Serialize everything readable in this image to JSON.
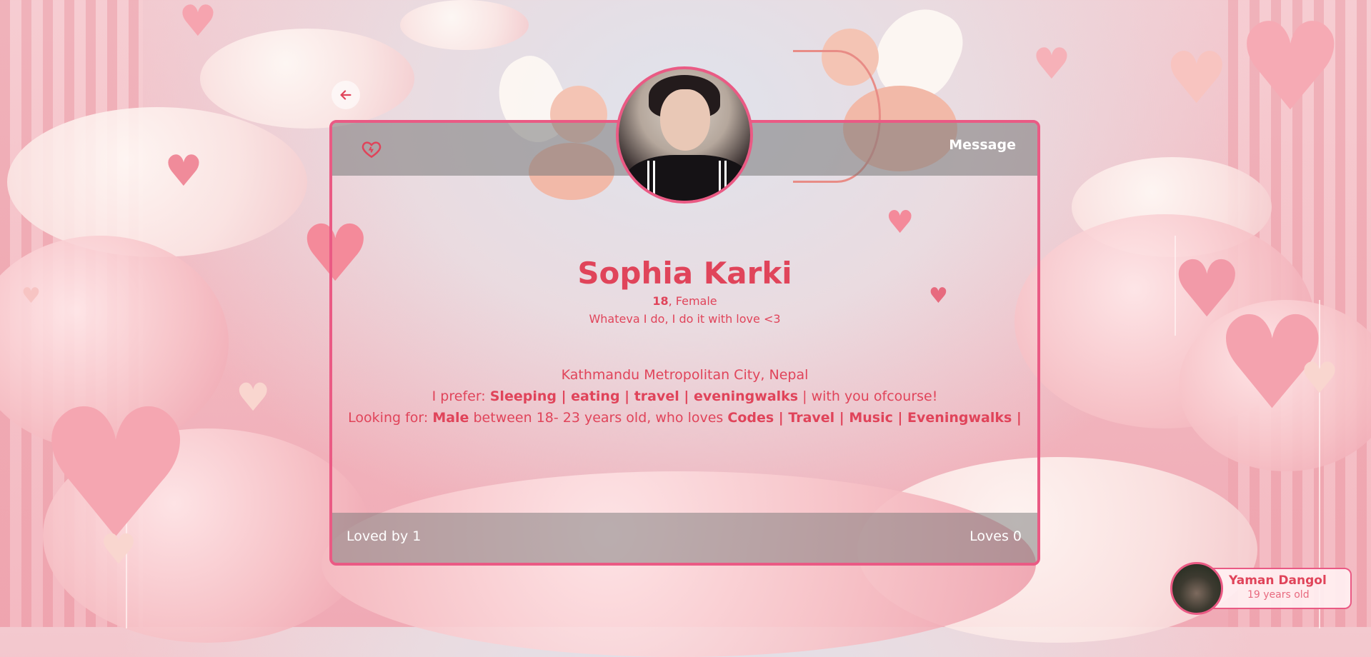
{
  "profile": {
    "name": "Sophia Karki",
    "age": "18",
    "gender_suffix": ", Female",
    "bio": "Whateva I do, I do it with love <3",
    "location": "Kathmandu Metropolitan City, Nepal",
    "prefer_label": "I prefer: ",
    "prefer_items": "Sleeping | eating | travel | eveningwalks",
    "prefer_suffix": " | with you ofcourse!",
    "looking_label": "Looking for: ",
    "looking_gender": "Male",
    "looking_middle": " between 18- 23 years old, who loves ",
    "looking_items": "Codes | Travel | Music | Eveningwalks |"
  },
  "card": {
    "message_label": "Message",
    "loved_by": "Loved by 1",
    "loves": "Loves 0"
  },
  "current_user": {
    "name": "Yaman Dangol",
    "age": "19 years old"
  },
  "colors": {
    "accent": "#ea5a84",
    "text": "#e0445a"
  },
  "icons": {
    "back": "arrow-left-icon",
    "like": "heart-outline-icon"
  }
}
